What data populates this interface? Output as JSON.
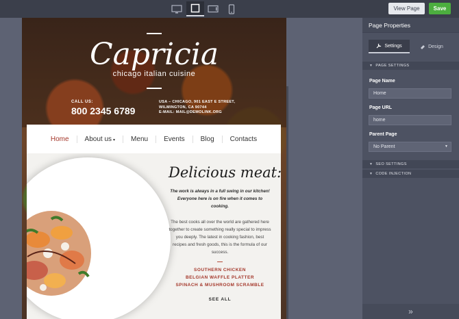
{
  "toolbar": {
    "devices": [
      {
        "name": "desktop",
        "icon": "monitor-icon",
        "active": false
      },
      {
        "name": "tablet-landscape",
        "icon": "tablet-landscape-icon",
        "active": true
      },
      {
        "name": "tablet",
        "icon": "tablet-icon",
        "active": false
      },
      {
        "name": "mobile",
        "icon": "phone-icon",
        "active": false
      }
    ],
    "view_page_label": "View Page",
    "save_label": "Save"
  },
  "preview": {
    "logo": "Capricia",
    "tagline": "chicago italian cuisine",
    "call_label": "CALL US:",
    "phone": "800 2345 6789",
    "address_lines": [
      "USA – CHICAGO, 901 EAST E STREET,",
      "WILMINGTON, CA 90744",
      "E-MAIL: MAIL@DEMOLINK.ORG"
    ],
    "menu": [
      {
        "label": "Home",
        "active": true
      },
      {
        "label": "About us",
        "has_dropdown": true
      },
      {
        "label": "Menu"
      },
      {
        "label": "Events"
      },
      {
        "label": "Blog"
      },
      {
        "label": "Contacts"
      }
    ],
    "heading": "Delicious meat:",
    "intro": "The work is always in a full swing in our kitchen! Everyone here is on fire when it comes to cooking.",
    "body": "The best cooks all over the world are gathered here together to create something really special to impress you deeply. The latest in cooking fashion, best recipes and fresh goods, this is the formula of our success.",
    "dishes": [
      "SOUTHERN CHICKEN",
      "BELGIAN WAFFLE PLATTER",
      "SPINACH & MUSHROOM SCRAMBLE"
    ],
    "see_all": "SEE ALL"
  },
  "panel": {
    "title": "Page Properties",
    "tabs": [
      {
        "label": "Settings",
        "icon": "wrench-icon",
        "active": true
      },
      {
        "label": "Design",
        "icon": "paint-icon",
        "active": false
      }
    ],
    "page_settings_label": "PAGE SETTINGS",
    "page_name_label": "Page Name",
    "page_name_value": "Home",
    "page_url_label": "Page URL",
    "page_url_value": "home",
    "parent_page_label": "Parent Page",
    "parent_page_value": "No Parent",
    "seo_settings_label": "SEO SETTINGS",
    "code_injection_label": "CODE INJECTION",
    "footer_icon": "double-chevron-right-icon"
  },
  "colors": {
    "accent_red": "#a4372a",
    "save_green": "#4cae3f",
    "panel_bg": "#4d5262",
    "toolbar_bg": "#3b3f4b"
  }
}
